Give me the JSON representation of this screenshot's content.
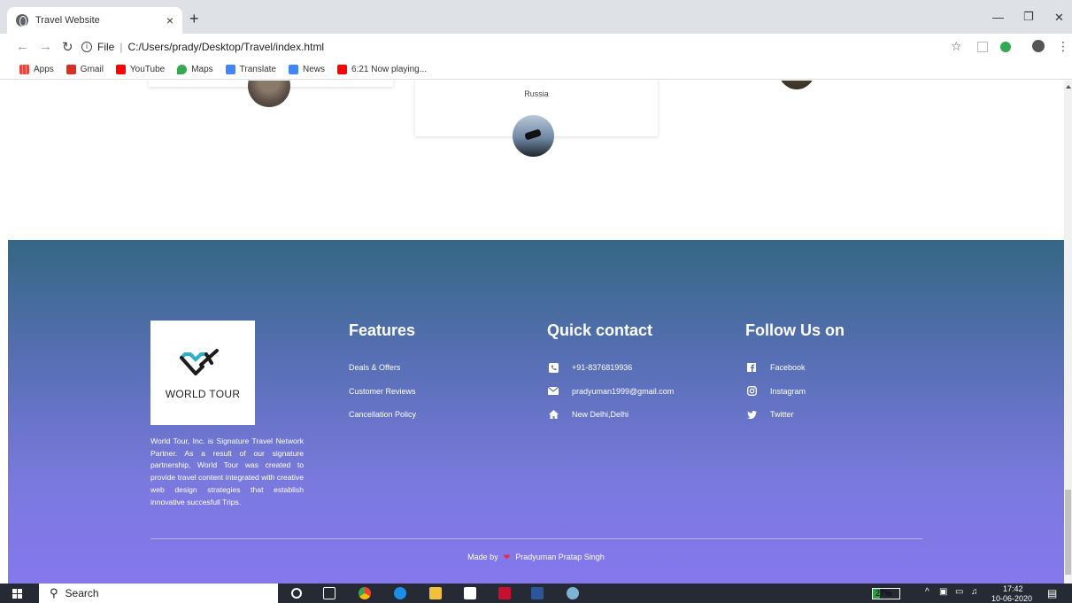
{
  "browser": {
    "tab_title": "Travel Website",
    "tab_close": "×",
    "new_tab": "+",
    "url_scheme": "File",
    "url_path": "C:/Users/prady/Desktop/Travel/index.html",
    "bookmarks": [
      {
        "label": "Apps",
        "color": "#e8453c"
      },
      {
        "label": "Gmail",
        "color": "#d93025"
      },
      {
        "label": "YouTube",
        "color": "#ff0000"
      },
      {
        "label": "Maps",
        "color": "#34a853"
      },
      {
        "label": "Translate",
        "color": "#4285f4"
      },
      {
        "label": "News",
        "color": "#4285f4"
      },
      {
        "label": "6:21 Now playing...",
        "color": "#ff0000"
      }
    ]
  },
  "page": {
    "card_location": "Russia"
  },
  "footer": {
    "brand": "WORLD TOUR",
    "about": "World Tour, Inc. is Signature Travel Network Partner. As a result of our signature partnership, World Tour was created to provide travel content integrated with creative web design strategies that establish innovative succesfull Trips.",
    "features": {
      "title": "Features",
      "links": [
        "Deals & Offers",
        "Customer Reviews",
        "Cancellation Policy"
      ]
    },
    "contact": {
      "title": "Quick contact",
      "phone": "+91-8376819936",
      "email": "pradyuman1999@gmail.com",
      "address": "New Delhi,Delhi"
    },
    "social": {
      "title": "Follow Us on",
      "facebook": "Facebook",
      "instagram": "Instagram",
      "twitter": "Twitter"
    },
    "made_by_prefix": "Made by",
    "made_by_name": "Pradyuman Pratap Singh"
  },
  "taskbar": {
    "search_placeholder": "Search",
    "battery": "27%",
    "battery_level": 0.27,
    "time": "17:42",
    "date": "10-06-2020"
  },
  "colors": {
    "footer_top": "#346784",
    "footer_bottom": "#8578ee",
    "heart": "#f0284a"
  }
}
